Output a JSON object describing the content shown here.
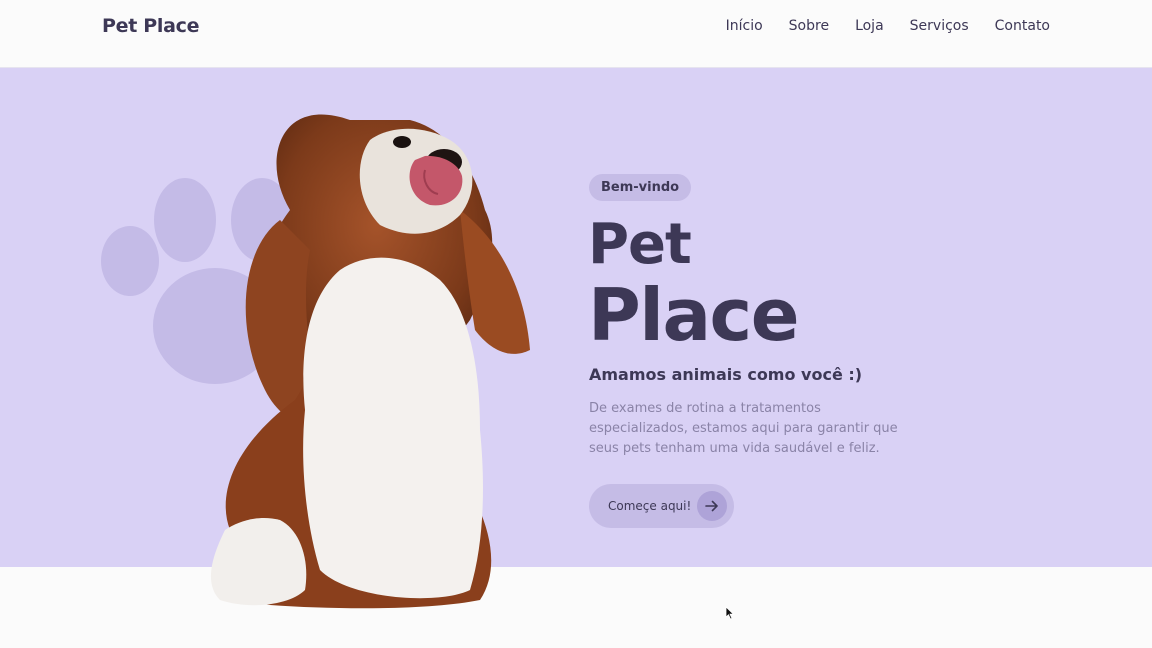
{
  "header": {
    "logo": "Pet Place",
    "nav": [
      "Início",
      "Sobre",
      "Loja",
      "Serviços",
      "Contato"
    ]
  },
  "hero": {
    "badge": "Bem-vindo",
    "title_line1": "Pet",
    "title_line2": "Place",
    "subtitle": "Amamos animais como você :)",
    "description": "De exames de rotina a tratamentos especializados, estamos aqui para garantir que seus pets tenham uma vida saudável e feliz.",
    "cta_label": "Começe aqui!",
    "cta_icon": "arrow-right-icon",
    "image": "cavalier-king-charles-spaniel-dog"
  },
  "colors": {
    "hero_background": "#d9d1f5",
    "accent": "#c5bce6",
    "text_dark": "#3d3856",
    "text_muted": "#8a83a7",
    "paw": "#c4bbe7"
  }
}
